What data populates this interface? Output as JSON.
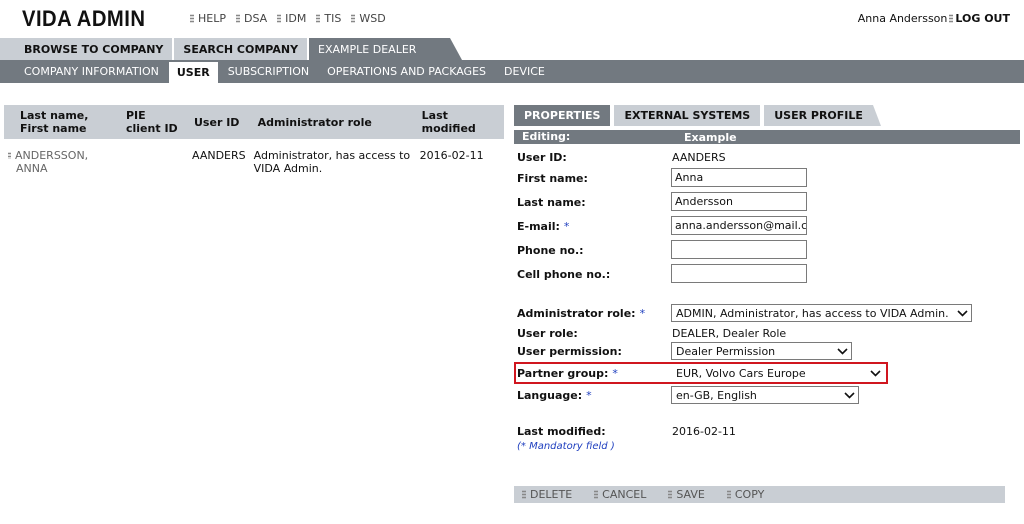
{
  "app": {
    "logo": "VIDA ADMIN"
  },
  "top_links": [
    "HELP",
    "DSA",
    "IDM",
    "TIS",
    "WSD"
  ],
  "user": {
    "name": "Anna Andersson",
    "logout": "LOG OUT"
  },
  "nav1": {
    "tabs": [
      "BROWSE TO COMPANY",
      "SEARCH COMPANY",
      "EXAMPLE DEALER"
    ],
    "active": "EXAMPLE DEALER"
  },
  "nav2": {
    "tabs": [
      "COMPANY INFORMATION",
      "USER",
      "SUBSCRIPTION",
      "OPERATIONS AND PACKAGES",
      "DEVICE"
    ],
    "active": "USER"
  },
  "list": {
    "headers": [
      "Last name, First name",
      "PIE client ID",
      "User ID",
      "Administrator role",
      "Last modified"
    ],
    "rows": [
      {
        "name": "ANDERSSON, ANNA",
        "pie_client_id": "",
        "user_id": "AANDERS",
        "admin_role": "Administrator, has access to VIDA Admin.",
        "last_modified": "2016-02-11"
      }
    ]
  },
  "panel": {
    "tabs": [
      "PROPERTIES",
      "EXTERNAL SYSTEMS",
      "USER PROFILE"
    ],
    "active_tab": "PROPERTIES",
    "editing_label": "Editing:",
    "editing_value": "Example"
  },
  "form": {
    "user_id": {
      "label": "User ID:",
      "value": "AANDERS"
    },
    "first_name": {
      "label": "First name:",
      "value": "Anna"
    },
    "last_name": {
      "label": "Last name:",
      "value": "Andersson"
    },
    "email": {
      "label": "E-mail:",
      "value": "anna.andersson@mail.com"
    },
    "phone": {
      "label": "Phone no.:",
      "value": ""
    },
    "cell_phone": {
      "label": "Cell phone no.:",
      "value": ""
    },
    "admin_role": {
      "label": "Administrator role:",
      "value": "ADMIN, Administrator, has access to VIDA Admin."
    },
    "user_role": {
      "label": "User role:",
      "value": "DEALER, Dealer Role"
    },
    "user_permission": {
      "label": "User permission:",
      "value": "Dealer Permission"
    },
    "partner_group": {
      "label": "Partner group:",
      "value": "EUR, Volvo Cars Europe"
    },
    "language": {
      "label": "Language:",
      "value": "en-GB, English"
    },
    "last_modified": {
      "label": "Last modified:",
      "value": "2016-02-11"
    },
    "required_marker": "*",
    "mandatory_note": "(* Mandatory field )"
  },
  "actions": [
    "DELETE",
    "CANCEL",
    "SAVE",
    "COPY"
  ],
  "colors": {
    "tab_active": "#727980",
    "tab_inactive": "#c9ced4",
    "highlight": "#d0161f",
    "required": "#1f3fbf"
  }
}
